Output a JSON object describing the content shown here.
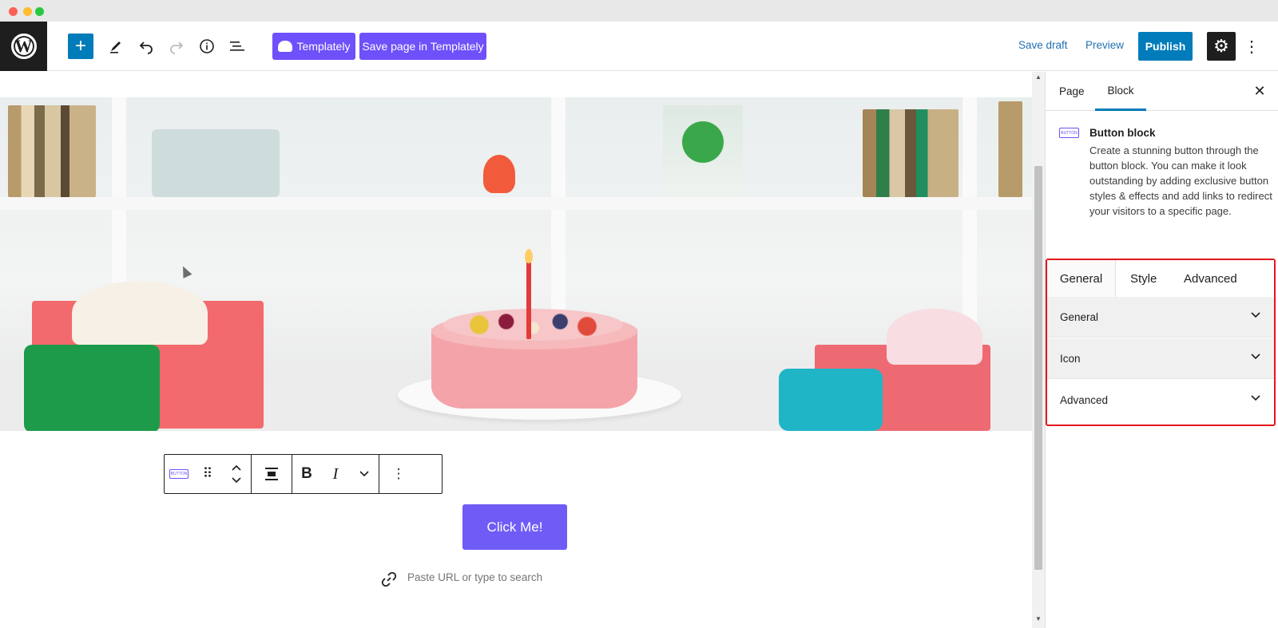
{
  "window": {
    "controls": [
      "close",
      "minimize",
      "maximize"
    ]
  },
  "header": {
    "logo_text": "W",
    "tools": {
      "add_icon": "plus-icon",
      "edit_icon": "pencil-icon",
      "undo_icon": "undo-icon",
      "redo_icon": "redo-icon",
      "info_icon": "info-icon",
      "list_icon": "list-view-icon"
    },
    "templately_label": "Templately",
    "save_templately_label": "Save page in Templately",
    "save_draft_label": "Save draft",
    "preview_label": "Preview",
    "publish_label": "Publish"
  },
  "canvas": {
    "button_label": "Click Me!",
    "url_placeholder": "Paste URL or type to search",
    "toolbar": {
      "block_icon_text": "BUTTON",
      "bold": "B",
      "italic": "I"
    }
  },
  "sidebar": {
    "tabs": [
      "Page",
      "Block"
    ],
    "active_tab": "Block",
    "block": {
      "icon_text": "BUTTON",
      "title": "Button block",
      "description": "Create a stunning button through the button block. You can make it look outstanding by adding exclusive button styles & effects and add links to redirect your visitors to a specific page."
    },
    "panel_tabs": [
      "General",
      "Style",
      "Advanced"
    ],
    "active_panel_tab": "General",
    "accordions": [
      "General",
      "Icon",
      "Advanced"
    ]
  },
  "colors": {
    "wp_blue": "#007cba",
    "templately_purple": "#6f50fa",
    "highlight_red": "#e3161c",
    "button_purple": "#6f5cf6"
  }
}
